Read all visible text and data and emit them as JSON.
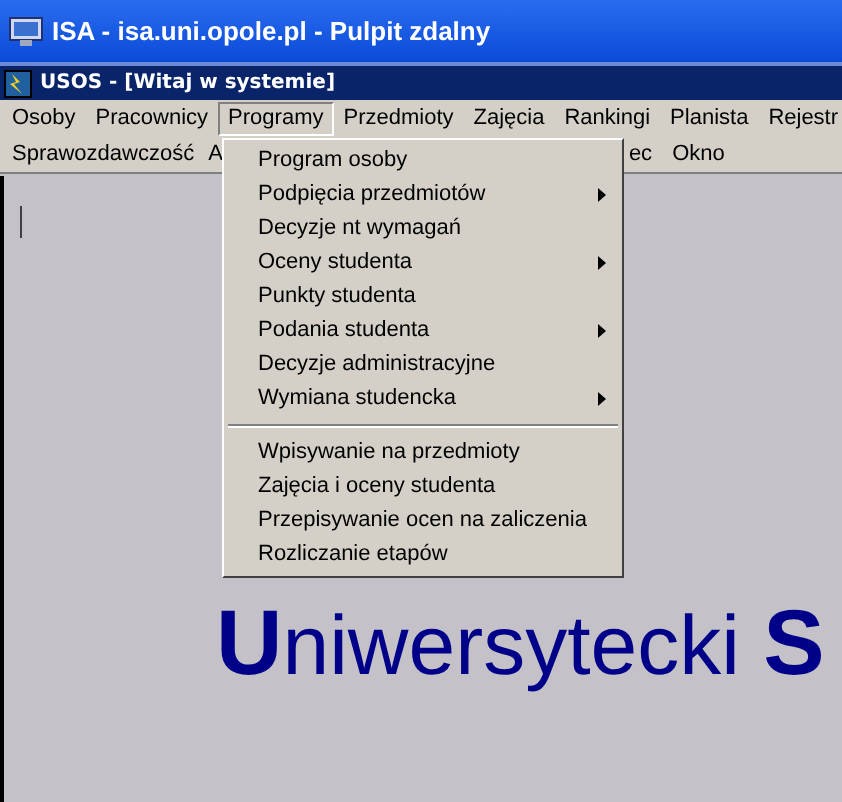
{
  "remote_window": {
    "title": "ISA - isa.uni.opole.pl - Pulpit zdalny"
  },
  "app_window": {
    "title": "USOS - [Witaj w systemie]"
  },
  "menubar": {
    "upper_row": [
      {
        "label": "Osoby",
        "selected": false
      },
      {
        "label": "Pracownicy",
        "selected": false
      },
      {
        "label": "Programy",
        "selected": true
      },
      {
        "label": "Przedmioty",
        "selected": false
      },
      {
        "label": "Zajęcia",
        "selected": false
      },
      {
        "label": "Rankingi",
        "selected": false
      },
      {
        "label": "Planista",
        "selected": false
      },
      {
        "label": "Rejestr",
        "selected": false
      }
    ],
    "lower_row": [
      {
        "label": "Sprawozdawczość",
        "selected": false
      },
      {
        "label": "A",
        "selected": false
      },
      {
        "label": "ec",
        "selected": false
      },
      {
        "label": "Okno",
        "selected": false
      }
    ]
  },
  "dropdown": {
    "items": [
      {
        "kind": "item",
        "label": "Program osoby",
        "submenu": false
      },
      {
        "kind": "item",
        "label": "Podpięcia przedmiotów",
        "submenu": true
      },
      {
        "kind": "item",
        "label": "Decyzje nt wymagań",
        "submenu": false
      },
      {
        "kind": "item",
        "label": "Oceny studenta",
        "submenu": true
      },
      {
        "kind": "item",
        "label": "Punkty studenta",
        "submenu": false
      },
      {
        "kind": "item",
        "label": "Podania studenta",
        "submenu": true
      },
      {
        "kind": "item",
        "label": "Decyzje administracyjne",
        "submenu": false
      },
      {
        "kind": "item",
        "label": "Wymiana studencka",
        "submenu": true
      },
      {
        "kind": "separator"
      },
      {
        "kind": "item",
        "label": "Wpisywanie na przedmioty",
        "submenu": false
      },
      {
        "kind": "item",
        "label": "Zajęcia i oceny studenta",
        "submenu": false
      },
      {
        "kind": "item",
        "label": "Przepisywanie ocen na zaliczenia",
        "submenu": false
      },
      {
        "kind": "item",
        "label": "Rozliczanie etapów",
        "submenu": false
      }
    ]
  },
  "content": {
    "heading": "**U**niwersytecki **S**"
  }
}
